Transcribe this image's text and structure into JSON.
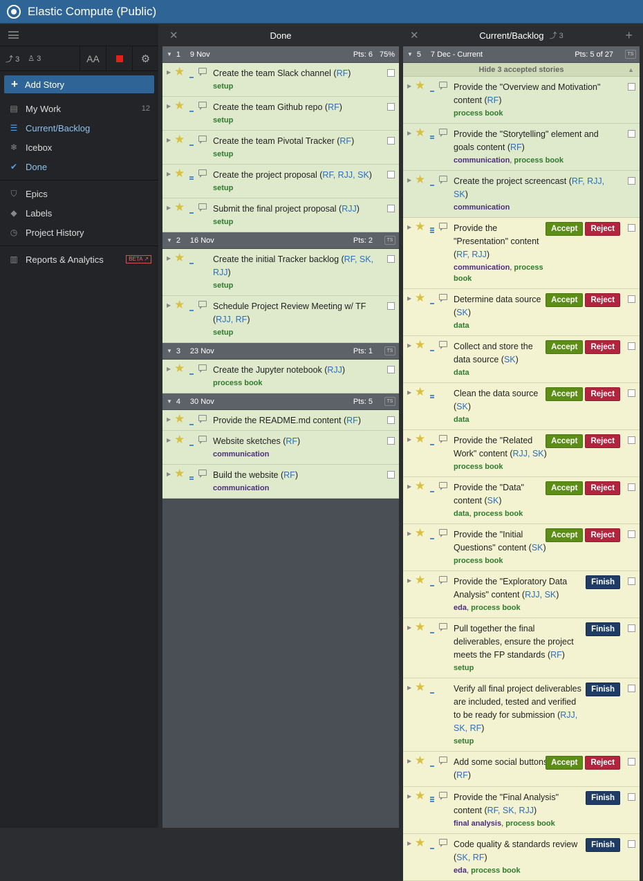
{
  "app": {
    "title": "Elastic Compute (Public)"
  },
  "sidebar": {
    "tools": {
      "velocity": "3",
      "members": "3",
      "font_size": "AA"
    },
    "add_story": "Add Story",
    "items": [
      {
        "label": "My Work",
        "count": "12"
      },
      {
        "label": "Current/Backlog"
      },
      {
        "label": "Icebox"
      },
      {
        "label": "Done"
      },
      {
        "label": "Epics"
      },
      {
        "label": "Labels"
      },
      {
        "label": "Project History"
      },
      {
        "label": "Reports & Analytics",
        "badge": "BETA"
      }
    ]
  },
  "done": {
    "title": "Done",
    "iterations": [
      {
        "num": "1",
        "date": "9 Nov",
        "pts": "Pts: 6",
        "pct": "75%",
        "stories": [
          {
            "name": "Create the team Slack channel (",
            "owners": "RF",
            "end": ")",
            "labels": "setup"
          },
          {
            "name": "Create the team Github repo (",
            "owners": "RF",
            "end": ")",
            "labels": "setup"
          },
          {
            "name": "Create the team Pivotal Tracker (",
            "owners": "RF",
            "end": ")",
            "labels": "setup"
          },
          {
            "name": "Create the project proposal (",
            "owners": "RF, RJJ, SK",
            "end": ")",
            "labels": "setup"
          },
          {
            "name": "Submit the final project proposal (",
            "owners": "RJJ",
            "end": ")",
            "labels": "setup"
          }
        ]
      },
      {
        "num": "2",
        "date": "16 Nov",
        "pts": "Pts: 2",
        "ts": "TS",
        "stories": [
          {
            "name": "Create the initial Tracker backlog (",
            "owners": "RF, SK, RJJ",
            "end": ")",
            "labels": "setup"
          },
          {
            "name": "Schedule Project Review Meeting w/ TF (",
            "owners": "RJJ, RF",
            "end": ")",
            "labels": "setup"
          }
        ]
      },
      {
        "num": "3",
        "date": "23 Nov",
        "pts": "Pts: 1",
        "ts": "TS",
        "stories": [
          {
            "name": "Create the Jupyter notebook (",
            "owners": "RJJ",
            "end": ")",
            "labels": "process book"
          }
        ]
      },
      {
        "num": "4",
        "date": "30 Nov",
        "pts": "Pts: 5",
        "ts": "TS",
        "stories": [
          {
            "name": "Provide the README.md content (",
            "owners": "RF",
            "end": ")",
            "labels": ""
          },
          {
            "name": "Website sketches (",
            "owners": "RF",
            "end": ")",
            "labels": "communication"
          },
          {
            "name": "Build the website (",
            "owners": "RF",
            "end": ")",
            "labels": "communication"
          }
        ]
      }
    ]
  },
  "current": {
    "title": "Current/Backlog",
    "velocity": "3",
    "iteration": {
      "num": "5",
      "date": "7 Dec - Current",
      "pts": "Pts: 5 of 27",
      "ts": "TS"
    },
    "hide_accepted": "Hide 3 accepted stories",
    "accepted": [
      {
        "name": "Provide the \"Overview and Motivation\" content (",
        "owners": "RF",
        "end": ")",
        "labels": [
          "process book"
        ]
      },
      {
        "name": "Provide the \"Storytelling\" element and goals content (",
        "owners": "RF",
        "end": ")",
        "labels": [
          "communication",
          "process book"
        ]
      },
      {
        "name": "Create the project screencast (",
        "owners": "RF, RJJ, SK",
        "end": ")",
        "labels": [
          "communication"
        ]
      }
    ],
    "stories": [
      {
        "name": "Provide the \"Presentation\" content (",
        "owners": "RF, RJJ",
        "end": ")",
        "labels": [
          "communication",
          "process book"
        ],
        "buttons": [
          "Accept",
          "Reject"
        ]
      },
      {
        "name": "Determine data source (",
        "owners": "SK",
        "end": ")",
        "labels": [
          "data"
        ],
        "buttons": [
          "Accept",
          "Reject"
        ]
      },
      {
        "name": "Collect and store the data source (",
        "owners": "SK",
        "end": ")",
        "labels": [
          "data"
        ],
        "buttons": [
          "Accept",
          "Reject"
        ]
      },
      {
        "name": "Clean the data source (",
        "owners": "SK",
        "end": ")",
        "labels": [
          "data"
        ],
        "buttons": [
          "Accept",
          "Reject"
        ]
      },
      {
        "name": "Provide the \"Related Work\" content (",
        "owners": "RJJ, SK",
        "end": ")",
        "labels": [
          "process book"
        ],
        "buttons": [
          "Accept",
          "Reject"
        ]
      },
      {
        "name": "Provide the \"Data\" content (",
        "owners": "SK",
        "end": ")",
        "labels": [
          "data",
          "process book"
        ],
        "buttons": [
          "Accept",
          "Reject"
        ]
      },
      {
        "name": "Provide the \"Initial Questions\" content (",
        "owners": "SK",
        "end": ")",
        "labels": [
          "process book"
        ],
        "buttons": [
          "Accept",
          "Reject"
        ]
      },
      {
        "name": "Provide the \"Exploratory Data Analysis\" content (",
        "owners": "RJJ, SK",
        "end": ")",
        "labels": [
          "eda",
          "process book"
        ],
        "buttons": [
          "Finish"
        ]
      },
      {
        "name": "Pull together the final deliverables, ensure the project meets the FP standards (",
        "owners": "RF",
        "end": ")",
        "labels": [
          "setup"
        ],
        "buttons": [
          "Finish"
        ]
      },
      {
        "name": "Verify all final project deliverables are included, tested and verified to be ready for submission (",
        "owners": "RJJ, SK, RF",
        "end": ")",
        "labels": [
          "setup"
        ],
        "buttons": [
          "Finish"
        ]
      },
      {
        "name": "Add some social buttons (",
        "owners": "RF",
        "end": ")",
        "labels": [],
        "buttons": [
          "Accept",
          "Reject"
        ]
      },
      {
        "name": "Provide the \"Final Analysis\" content (",
        "owners": "RF, SK, RJJ",
        "end": ")",
        "labels": [
          "final analysis",
          "process book"
        ],
        "buttons": [
          "Finish"
        ]
      },
      {
        "name": "Code quality & standards review (",
        "owners": "SK, RF",
        "end": ")",
        "labels": [
          "eda",
          "process book"
        ],
        "buttons": [
          "Finish"
        ]
      }
    ]
  },
  "colors": {
    "topbar": "#2f6596",
    "accept": "#5b8d17",
    "reject": "#b3243f",
    "finish": "#1f3c66",
    "accepted_bg": "#dfeacc",
    "unstarted_bg": "#f3f3d1"
  }
}
